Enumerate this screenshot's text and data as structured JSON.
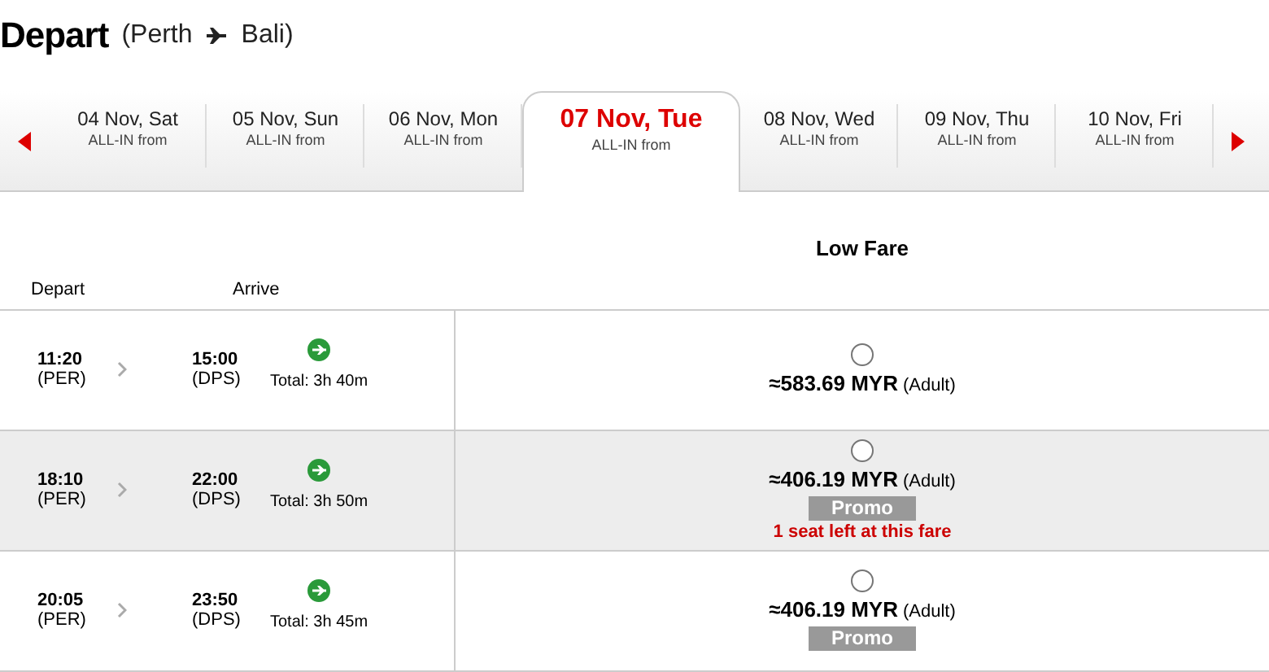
{
  "header": {
    "title": "Depart",
    "origin": "(Perth",
    "destination": "Bali)"
  },
  "dates": [
    {
      "date": "04 Nov, Sat",
      "sub": "ALL-IN from",
      "selected": false
    },
    {
      "date": "05 Nov, Sun",
      "sub": "ALL-IN from",
      "selected": false
    },
    {
      "date": "06 Nov, Mon",
      "sub": "ALL-IN from",
      "selected": false
    },
    {
      "date": "07 Nov, Tue",
      "sub": "ALL-IN from",
      "selected": true
    },
    {
      "date": "08 Nov, Wed",
      "sub": "ALL-IN from",
      "selected": false
    },
    {
      "date": "09 Nov, Thu",
      "sub": "ALL-IN from",
      "selected": false
    },
    {
      "date": "10 Nov, Fri",
      "sub": "ALL-IN from",
      "selected": false
    }
  ],
  "columns": {
    "depart": "Depart",
    "arrive": "Arrive",
    "fare": "Low Fare"
  },
  "flights": [
    {
      "depart_time": "11:20",
      "depart_code": "(PER)",
      "arrive_time": "15:00",
      "arrive_code": "(DPS)",
      "total": "Total: 3h 40m",
      "price": "≈583.69 MYR",
      "pax": "(Adult)",
      "selected": false
    },
    {
      "depart_time": "18:10",
      "depart_code": "(PER)",
      "arrive_time": "22:00",
      "arrive_code": "(DPS)",
      "total": "Total: 3h 50m",
      "price": "≈406.19 MYR",
      "pax": "(Adult)",
      "promo": "Promo",
      "note": "1 seat left at this fare",
      "selected": false
    },
    {
      "depart_time": "20:05",
      "depart_code": "(PER)",
      "arrive_time": "23:50",
      "arrive_code": "(DPS)",
      "total": "Total: 3h 45m",
      "price": "≈406.19 MYR",
      "pax": "(Adult)",
      "promo": "Promo",
      "selected": false
    }
  ]
}
